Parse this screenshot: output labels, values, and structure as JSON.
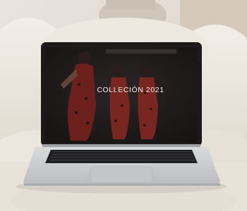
{
  "photo": {
    "screen_headline": "COLLECIÓN 2021",
    "colors": {
      "background_wall": "#e4dfd8",
      "sofa_boucle": "#efeae1",
      "laptop_silver": "#cfd1d3",
      "screen_dark": "#2a2525",
      "dress_red": "#b43a30"
    }
  }
}
